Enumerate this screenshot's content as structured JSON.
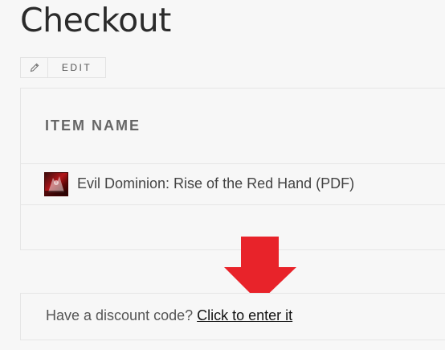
{
  "page": {
    "title": "Checkout"
  },
  "toolbar": {
    "edit_icon": "pencil-icon",
    "edit_label": "EDIT"
  },
  "cart": {
    "header": {
      "item_name_label": "ITEM NAME"
    },
    "items": [
      {
        "name": "Evil Dominion: Rise of the Red Hand (PDF)",
        "thumbnail": "product-thumbnail"
      }
    ]
  },
  "discount": {
    "prompt": "Have a discount code?",
    "link_label": "Click to enter it"
  },
  "annotation": {
    "arrow_icon": "arrow-down-icon",
    "arrow_color": "#e8232a"
  }
}
